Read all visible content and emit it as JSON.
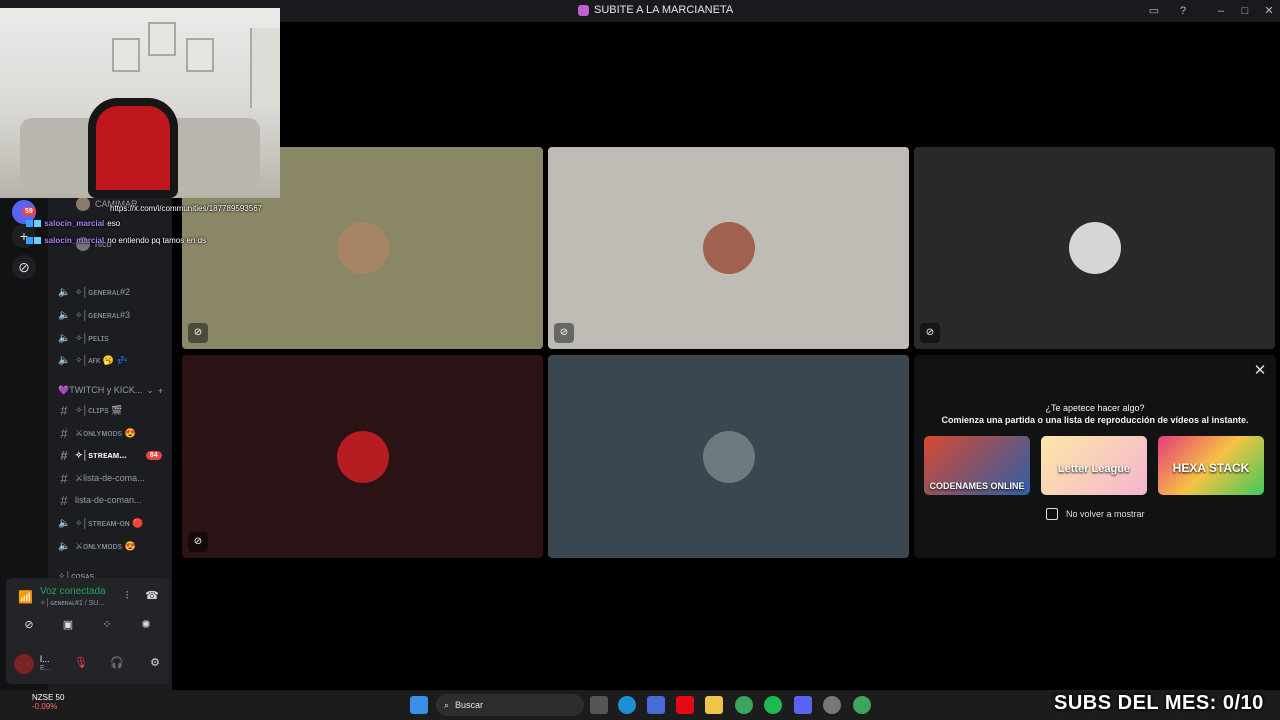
{
  "window": {
    "title": "SUBITE A LA MARCIANETA"
  },
  "server_rail": {
    "badge": "59"
  },
  "sidebar": {
    "voice_users": [
      {
        "name": "CAMIMAR..."
      },
      {
        "name": "anto"
      },
      {
        "name": "nico"
      }
    ],
    "channels_a": [
      {
        "label": "✧│ɢᴇɴᴇʀᴀʟ#2"
      },
      {
        "label": "✧│ɢᴇɴᴇʀᴀʟ#3"
      },
      {
        "label": "✧│ᴘᴇʟɪs"
      },
      {
        "label": "✧│ᴀғᴋ 🥱 💤"
      }
    ],
    "category": "💜TWITCH y KICK...",
    "channels_b": [
      {
        "type": "text",
        "label": "✧│ᴄʟɪᴘs 🎬"
      },
      {
        "type": "text",
        "label": "⚔ᴏɴʟʏᴍᴏᴅs 😍"
      },
      {
        "type": "text",
        "label": "✧│sᴛʀᴇᴀᴍ...",
        "badge": "84",
        "active": true
      },
      {
        "type": "text",
        "label": "⚔lista-de-coma..."
      },
      {
        "type": "text",
        "label": "lista-de-coman..."
      },
      {
        "type": "voice",
        "label": "✧│sᴛʀᴇᴀᴍ-ᴏɴ 🔴"
      },
      {
        "type": "voice",
        "label": "⚔ᴏɴʟʏᴍᴏᴅs 😍"
      }
    ],
    "category2": "✧│ᴄᴏsᴀs"
  },
  "voice_panel": {
    "status": "Voz conectada",
    "channel": "✧│ɢᴇɴᴇʀᴀʟ#1 / SU...",
    "user_name": "l...",
    "user_sub": "E..."
  },
  "chat": [
    {
      "name": "",
      "text": "https://x.com/i/communities/187789593567"
    },
    {
      "name": "salocin_marcial",
      "text": "eso"
    },
    {
      "name": "salocin_marcial",
      "text": "no entiendo pq tamos en ds"
    }
  ],
  "activity": {
    "question": "¿Te apetece hacer algo?",
    "description": "Comienza una partida o una lista de reproducción de vídeos al instante.",
    "games": [
      {
        "label": "CODENAMES ONLINE"
      },
      {
        "label": "Letter League"
      },
      {
        "label": "HEXA STACK"
      }
    ],
    "checkbox_label": "No volver a mostrar"
  },
  "taskbar": {
    "ticker_name": "NZSE 50",
    "ticker_change": "-0.09%",
    "search_label": "Buscar"
  },
  "overlay_text": "SUBS DEL MES: 0/10",
  "colors": {
    "tile1": "#8a8766",
    "tile2": "#bebcb5",
    "tile3": "#2a2829",
    "tile4": "#2a1215",
    "tile5": "#3a4650",
    "voice_green": "#23a559"
  }
}
